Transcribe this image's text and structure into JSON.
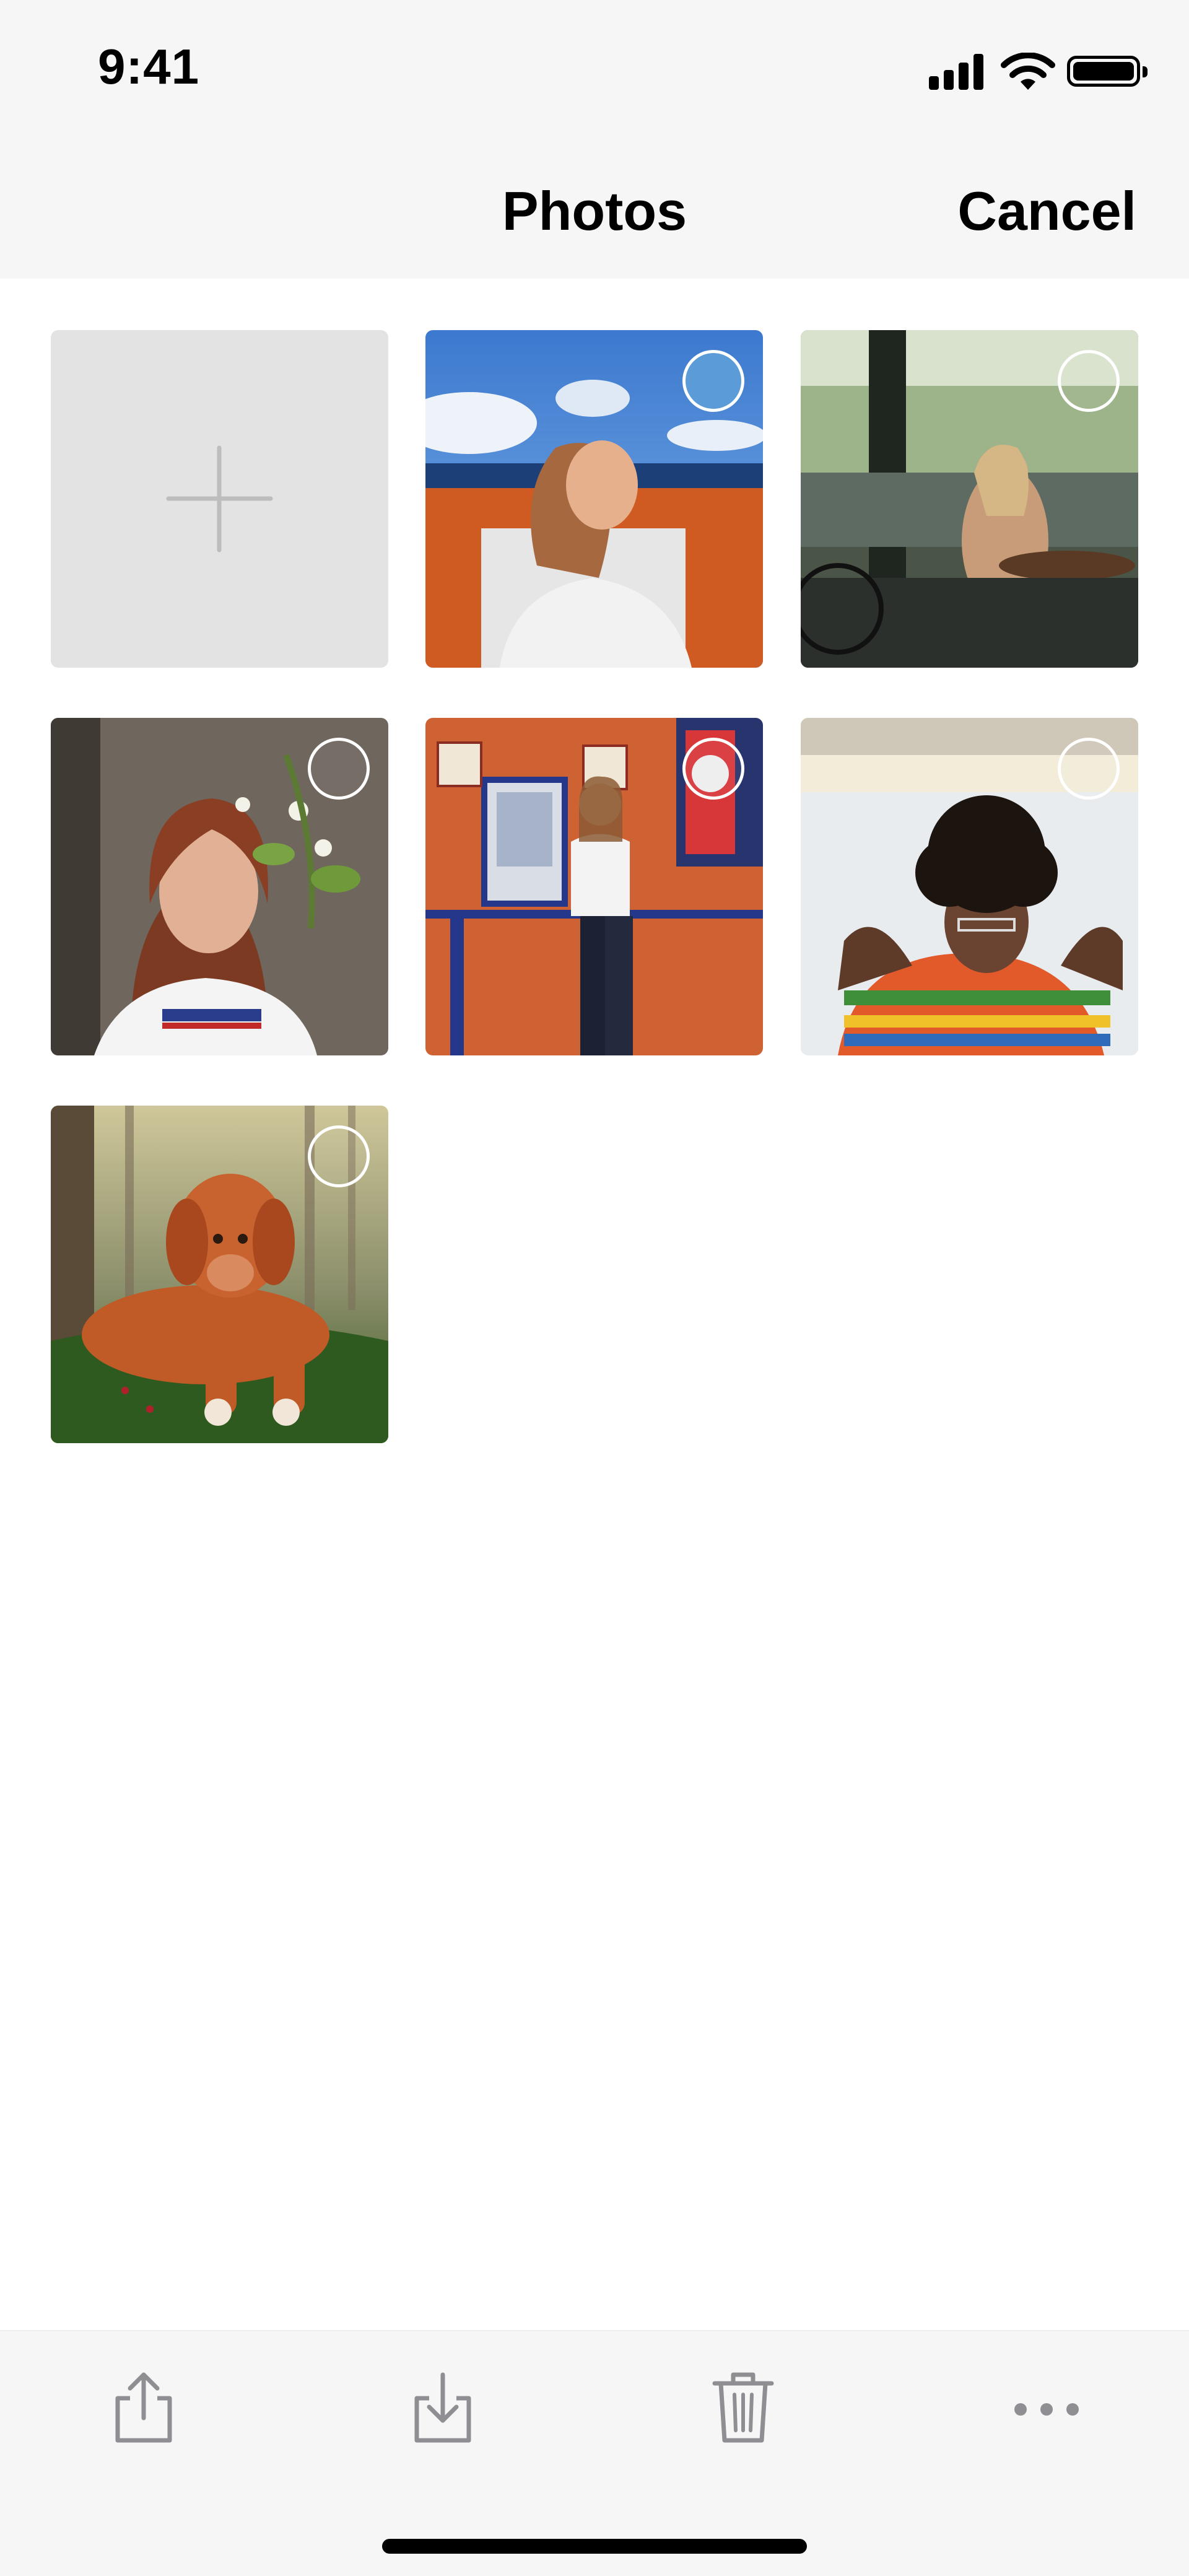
{
  "status_bar": {
    "time": "9:41",
    "icons": [
      "cellular-signal-icon",
      "wifi-icon",
      "battery-icon"
    ]
  },
  "nav": {
    "title": "Photos",
    "cancel_label": "Cancel"
  },
  "grid": {
    "add_tile": {
      "icon": "plus-icon"
    },
    "photos": [
      {
        "subject": "",
        "selected": true
      },
      {
        "subject": "",
        "selected": false
      },
      {
        "subject": "",
        "selected": false
      },
      {
        "subject": "",
        "selected": false
      },
      {
        "subject": "",
        "selected": false
      },
      {
        "subject": "",
        "selected": false
      }
    ]
  },
  "toolbar": {
    "buttons": [
      "share-icon",
      "download-icon",
      "trash-icon",
      "more-icon"
    ]
  },
  "colors": {
    "bar_background": "#f6f6f6",
    "add_tile_background": "#e3e3e3",
    "selection_accent": "#5b9bd8"
  }
}
